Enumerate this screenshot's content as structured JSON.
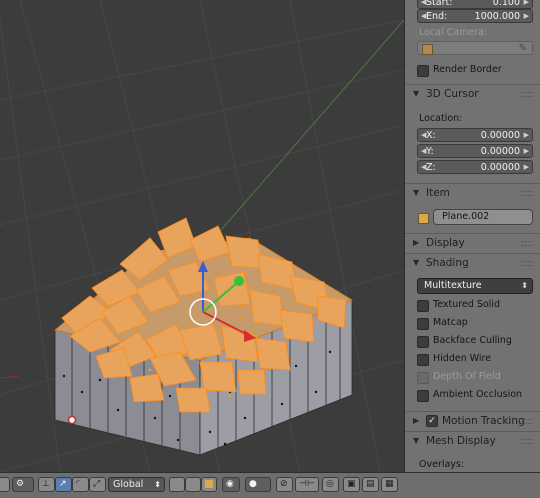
{
  "viewport": {
    "name": "3D Viewport"
  },
  "panel": {
    "clip": {
      "start_label": "Start:",
      "start_value": "0.100",
      "end_label": "End:",
      "end_value": "1000.000"
    },
    "local_camera_label": "Local Camera:",
    "render_border_label": "Render Border",
    "cursor_section": "3D Cursor",
    "location_label": "Location:",
    "cursor": [
      {
        "label": "X:",
        "value": "0.00000"
      },
      {
        "label": "Y:",
        "value": "0.00000"
      },
      {
        "label": "Z:",
        "value": "0.00000"
      }
    ],
    "item_section": "Item",
    "item_name": "Plane.002",
    "display_section": "Display",
    "shading_section": "Shading",
    "shading_mode": "Multitexture",
    "shading_options": [
      {
        "label": "Textured Solid",
        "checked": false,
        "enabled": true
      },
      {
        "label": "Matcap",
        "checked": false,
        "enabled": true
      },
      {
        "label": "Backface Culling",
        "checked": false,
        "enabled": true
      },
      {
        "label": "Hidden Wire",
        "checked": false,
        "enabled": true
      },
      {
        "label": "Depth Of Field",
        "checked": false,
        "enabled": false
      },
      {
        "label": "Ambient Occlusion",
        "checked": false,
        "enabled": true
      }
    ],
    "motion_tracking_section": "Motion Tracking",
    "mesh_display_section": "Mesh Display",
    "overlays_label": "Overlays:"
  },
  "toolbar": {
    "orientation": "Global"
  },
  "colors": {
    "accent": "#5d7fb0",
    "selected_face": "#e8a35c",
    "selected_edge": "#ff8c1a",
    "mesh_side": "#8e8e96"
  }
}
